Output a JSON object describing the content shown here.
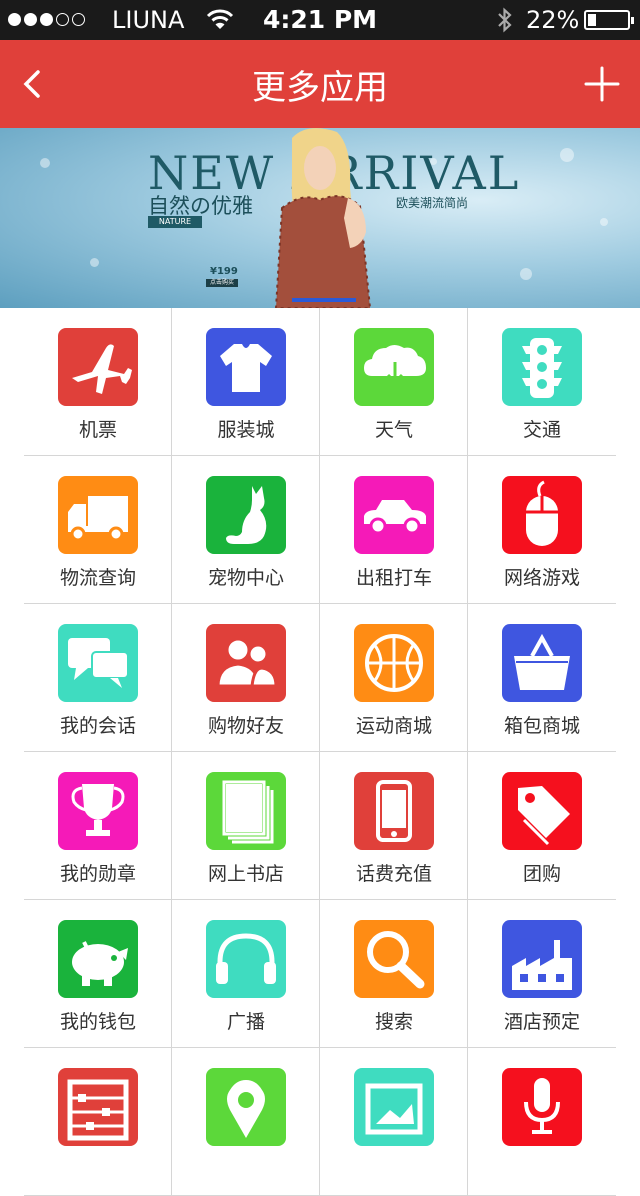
{
  "status": {
    "carrier": "LIUNA",
    "time": "4:21 PM",
    "battery_text": "22%",
    "battery_level": 0.22,
    "signal_bars": 3,
    "signal_total": 5
  },
  "nav": {
    "title": "更多应用"
  },
  "banner": {
    "headline": "NEW ARRIVAL",
    "subtitle": "自然の优雅",
    "tag": "NATURE",
    "right_text": "欧美潮流简尚",
    "price": "¥199",
    "buy": "点击购买"
  },
  "apps": [
    {
      "label": "机票",
      "icon": "airplane-icon",
      "color": "#e0403a"
    },
    {
      "label": "服装城",
      "icon": "tshirt-icon",
      "color": "#3f56e0"
    },
    {
      "label": "天气",
      "icon": "cloud-download-icon",
      "color": "#5cd83a"
    },
    {
      "label": "交通",
      "icon": "traffic-light-icon",
      "color": "#3fdcc0"
    },
    {
      "label": "物流查询",
      "icon": "truck-icon",
      "color": "#ff8c14"
    },
    {
      "label": "宠物中心",
      "icon": "cat-icon",
      "color": "#1ab33c"
    },
    {
      "label": "出租打车",
      "icon": "car-icon",
      "color": "#f51ab8"
    },
    {
      "label": "网络游戏",
      "icon": "mouse-icon",
      "color": "#f5101e"
    },
    {
      "label": "我的会话",
      "icon": "chat-icon",
      "color": "#3fdcc0"
    },
    {
      "label": "购物好友",
      "icon": "friends-icon",
      "color": "#e0403a"
    },
    {
      "label": "运动商城",
      "icon": "basketball-icon",
      "color": "#ff8c14"
    },
    {
      "label": "箱包商城",
      "icon": "basket-icon",
      "color": "#3f56e0"
    },
    {
      "label": "我的勋章",
      "icon": "trophy-icon",
      "color": "#f51ab8"
    },
    {
      "label": "网上书店",
      "icon": "book-icon",
      "color": "#5cd83a"
    },
    {
      "label": "话费充值",
      "icon": "phone-icon",
      "color": "#e0403a"
    },
    {
      "label": "团购",
      "icon": "tag-icon",
      "color": "#f5101e"
    },
    {
      "label": "我的钱包",
      "icon": "piggy-bank-icon",
      "color": "#1ab33c"
    },
    {
      "label": "广播",
      "icon": "headphones-icon",
      "color": "#3fdcc0"
    },
    {
      "label": "搜索",
      "icon": "search-icon",
      "color": "#ff8c14"
    },
    {
      "label": "酒店预定",
      "icon": "factory-icon",
      "color": "#3f56e0"
    },
    {
      "label": "",
      "icon": "abacus-icon",
      "color": "#e0403a"
    },
    {
      "label": "",
      "icon": "location-pin-icon",
      "color": "#5cd83a"
    },
    {
      "label": "",
      "icon": "picture-icon",
      "color": "#3fdcc0"
    },
    {
      "label": "",
      "icon": "microphone-icon",
      "color": "#f5101e"
    }
  ]
}
